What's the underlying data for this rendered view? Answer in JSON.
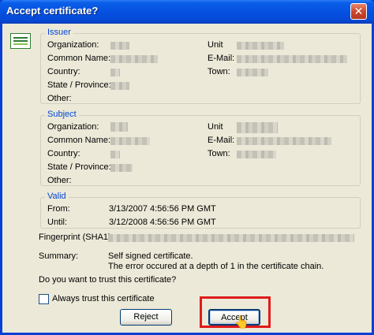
{
  "window": {
    "title": "Accept certificate?",
    "close_glyph": "✕"
  },
  "issuer": {
    "legend": "Issuer",
    "left_labels": [
      "Organization:",
      "Common Name:",
      "Country:",
      "State / Province:",
      "Other:"
    ],
    "right_labels": [
      "Unit",
      "E-Mail:",
      "Town:"
    ]
  },
  "subject": {
    "legend": "Subject",
    "left_labels": [
      "Organization:",
      "Common Name:",
      "Country:",
      "State / Province:",
      "Other:"
    ],
    "right_labels": [
      "Unit",
      "E-Mail:",
      "Town:"
    ]
  },
  "valid": {
    "legend": "Valid",
    "from_label": "From:",
    "from_value": "3/13/2007 4:56:56 PM GMT",
    "until_label": "Until:",
    "until_value": "3/12/2008 4:56:56 PM GMT"
  },
  "fingerprint": {
    "label": "Fingerprint (SHA1):"
  },
  "summary": {
    "label": "Summary:",
    "line1": "Self signed certificate.",
    "line2": "The error occured at a depth of 1 in the certificate chain."
  },
  "question": "Do you want to trust this certificate?",
  "always_trust": {
    "label": "Always trust this certificate",
    "checked": false
  },
  "buttons": {
    "reject": "Reject",
    "accept": "Accept"
  },
  "colors": {
    "highlight": "#e01b1b",
    "legend": "#0046d5",
    "titlebar": "#0551e0"
  }
}
